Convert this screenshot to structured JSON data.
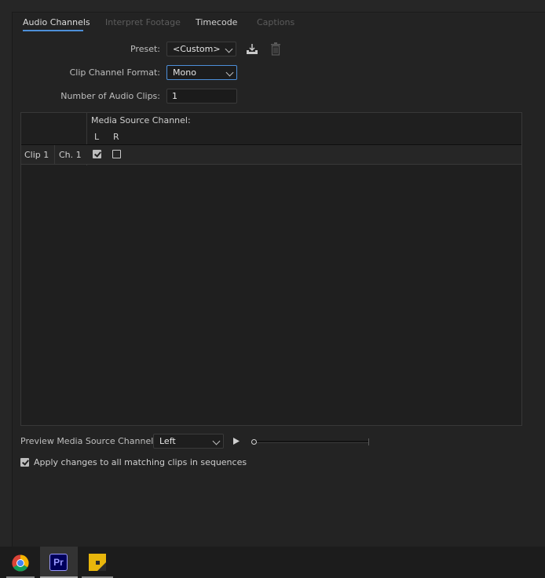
{
  "tabs": [
    {
      "label": "Audio Channels",
      "state": "active"
    },
    {
      "label": "Interpret Footage",
      "state": "disabled"
    },
    {
      "label": "Timecode",
      "state": "normal"
    },
    {
      "label": "Captions",
      "state": "disabled"
    }
  ],
  "preset": {
    "label": "Preset:",
    "value": "<Custom>"
  },
  "clip_format": {
    "label": "Clip Channel Format:",
    "value": "Mono"
  },
  "num_clips": {
    "label": "Number of Audio Clips:",
    "value": "1"
  },
  "grid": {
    "header": "Media Source Channel:",
    "channels": [
      "L",
      "R"
    ],
    "rows": [
      {
        "clip": "Clip 1",
        "ch": "Ch. 1",
        "L": true,
        "R": false
      }
    ]
  },
  "preview": {
    "label": "Preview Media Source Channel:",
    "value": "Left",
    "position": 0
  },
  "apply_all": {
    "label": "Apply changes to all matching clips in sequences",
    "checked": true
  },
  "colors": {
    "accent": "#4d8fd9",
    "background": "#232323"
  },
  "taskbar": {
    "apps": [
      {
        "name": "chrome-icon"
      },
      {
        "name": "premiere-icon",
        "text": "Pr",
        "active": true
      },
      {
        "name": "sticky-notes-icon"
      }
    ]
  }
}
